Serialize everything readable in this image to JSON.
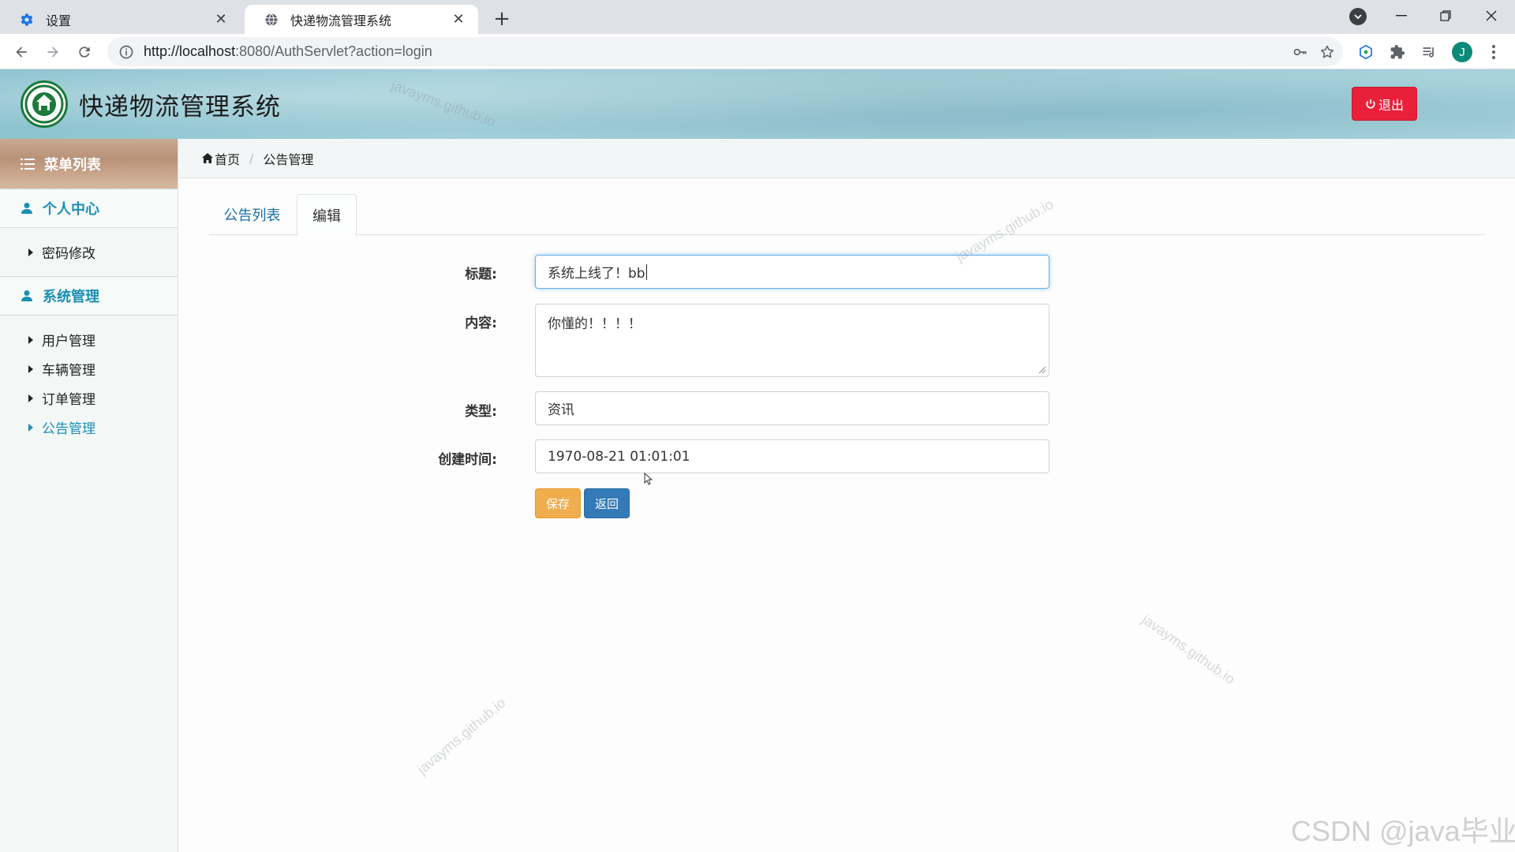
{
  "browser": {
    "tabs": [
      {
        "title": "设置",
        "icon": "gear-icon",
        "active": false
      },
      {
        "title": "快递物流管理系统",
        "icon": "globe-icon",
        "active": true
      }
    ],
    "url_host": "http://localhost",
    "url_rest": ":8080/AuthServlet?action=login",
    "profile_initial": "J"
  },
  "header": {
    "app_title": "快递物流管理系统",
    "logout_label": "退出"
  },
  "sidebar": {
    "menu_title": "菜单列表",
    "sections": [
      {
        "title": "个人中心",
        "items": [
          "密码修改"
        ]
      },
      {
        "title": "系统管理",
        "items": [
          "用户管理",
          "车辆管理",
          "订单管理",
          "公告管理"
        ]
      }
    ],
    "active_item": "公告管理"
  },
  "breadcrumb": {
    "home": "首页",
    "current": "公告管理"
  },
  "tabs": {
    "list_label": "公告列表",
    "edit_label": "编辑"
  },
  "form": {
    "title_label": "标题:",
    "title_value": "系统上线了！bb",
    "content_label": "内容:",
    "content_value": "你懂的！！！！",
    "type_label": "类型:",
    "type_value": "资讯",
    "created_label": "创建时间:",
    "created_value": "1970-08-21 01:01:01",
    "save_label": "保存",
    "back_label": "返回"
  },
  "watermark": "javayms.github.io",
  "credit": "CSDN @java毕业",
  "colors": {
    "accent_blue": "#1b8fb4",
    "logout_red": "#e8203a",
    "save_orange": "#f0ad4e",
    "back_blue": "#337ab7"
  }
}
